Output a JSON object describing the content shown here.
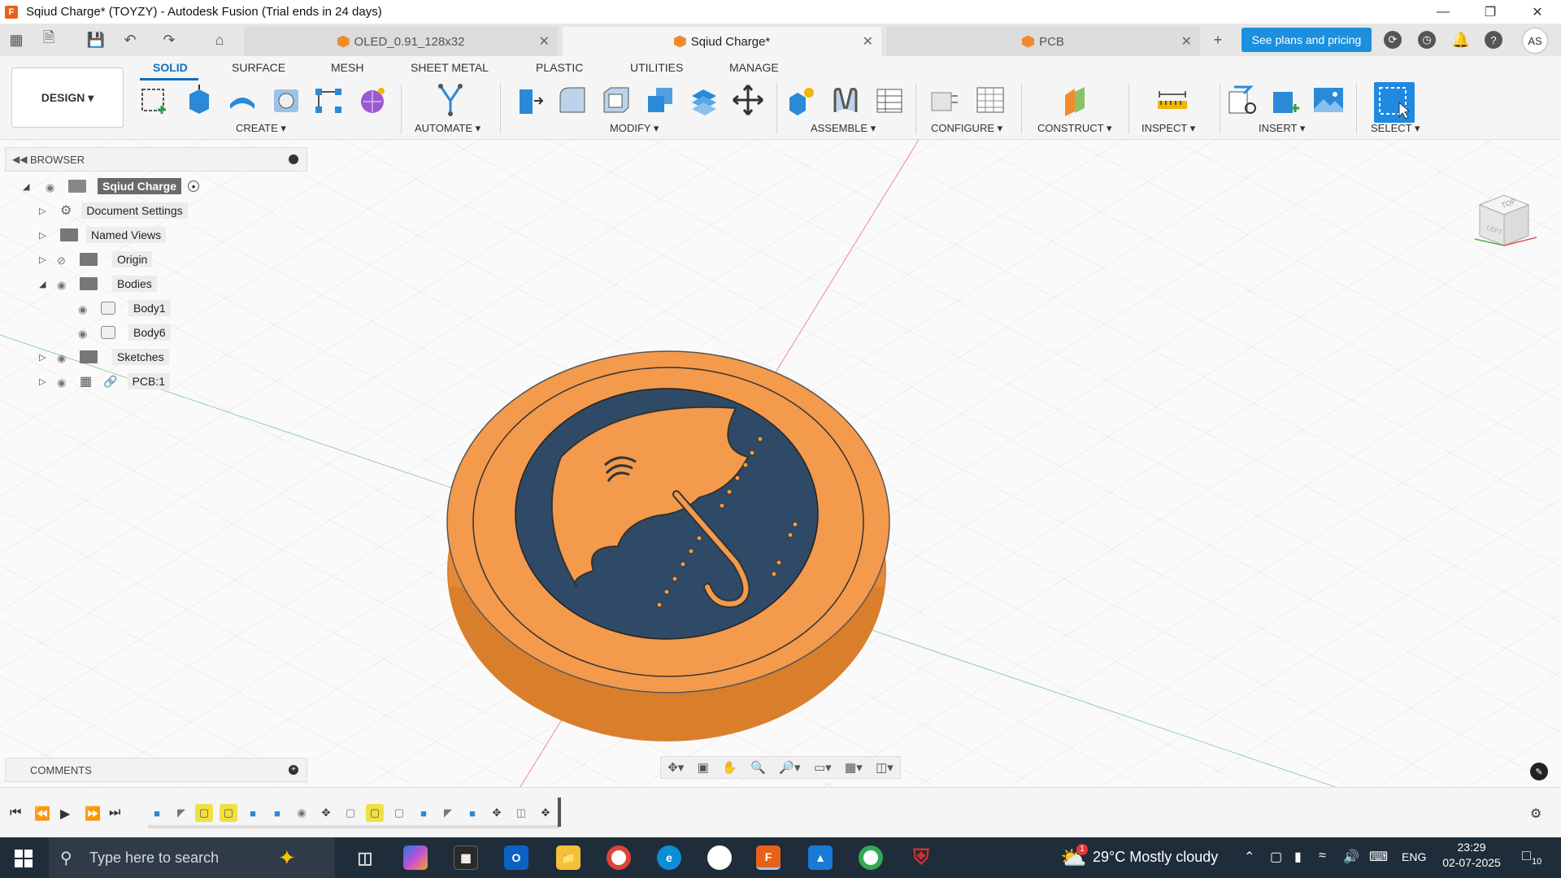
{
  "window": {
    "title": "Sqiud Charge* (TOYZY) - Autodesk Fusion (Trial ends in 24 days)",
    "app_icon_letter": "F"
  },
  "tabs": [
    {
      "label": "OLED_0.91_128x32",
      "active": false
    },
    {
      "label": "Sqiud Charge*",
      "active": true
    },
    {
      "label": "PCB",
      "active": false
    }
  ],
  "header": {
    "plans_label": "See plans and pricing",
    "user_initials": "AS"
  },
  "ribbon": {
    "workspace_label": "DESIGN ▾",
    "tabs": [
      "SOLID",
      "SURFACE",
      "MESH",
      "SHEET METAL",
      "PLASTIC",
      "UTILITIES",
      "MANAGE"
    ],
    "groups": [
      "CREATE ▾",
      "AUTOMATE ▾",
      "MODIFY ▾",
      "ASSEMBLE ▾",
      "CONFIGURE ▾",
      "CONSTRUCT ▾",
      "INSPECT ▾",
      "INSERT ▾",
      "SELECT ▾"
    ]
  },
  "browser": {
    "title": "BROWSER",
    "root": "Sqiud Charge",
    "items": [
      {
        "label": "Document Settings"
      },
      {
        "label": "Named Views"
      },
      {
        "label": "Origin"
      },
      {
        "label": "Bodies"
      },
      {
        "label": "Body1"
      },
      {
        "label": "Body6"
      },
      {
        "label": "Sketches"
      },
      {
        "label": "PCB:1"
      }
    ]
  },
  "comments": {
    "title": "COMMENTS"
  },
  "viewcube": {
    "top": "TOP",
    "left": "LEFT"
  },
  "taskbar": {
    "search_placeholder": "Type here to search",
    "weather": "29°C  Mostly cloudy",
    "language": "ENG",
    "time": "23:29",
    "date": "02-07-2025",
    "notification_count": "10",
    "weather_badge": "1",
    "fusion_label": "F"
  },
  "colors": {
    "accent": "#0e6fc2",
    "plans_button": "#1c8fde",
    "model_orange": "#f39a4d",
    "model_dark": "#2e4a66",
    "taskbar": "#1f2d3a"
  }
}
